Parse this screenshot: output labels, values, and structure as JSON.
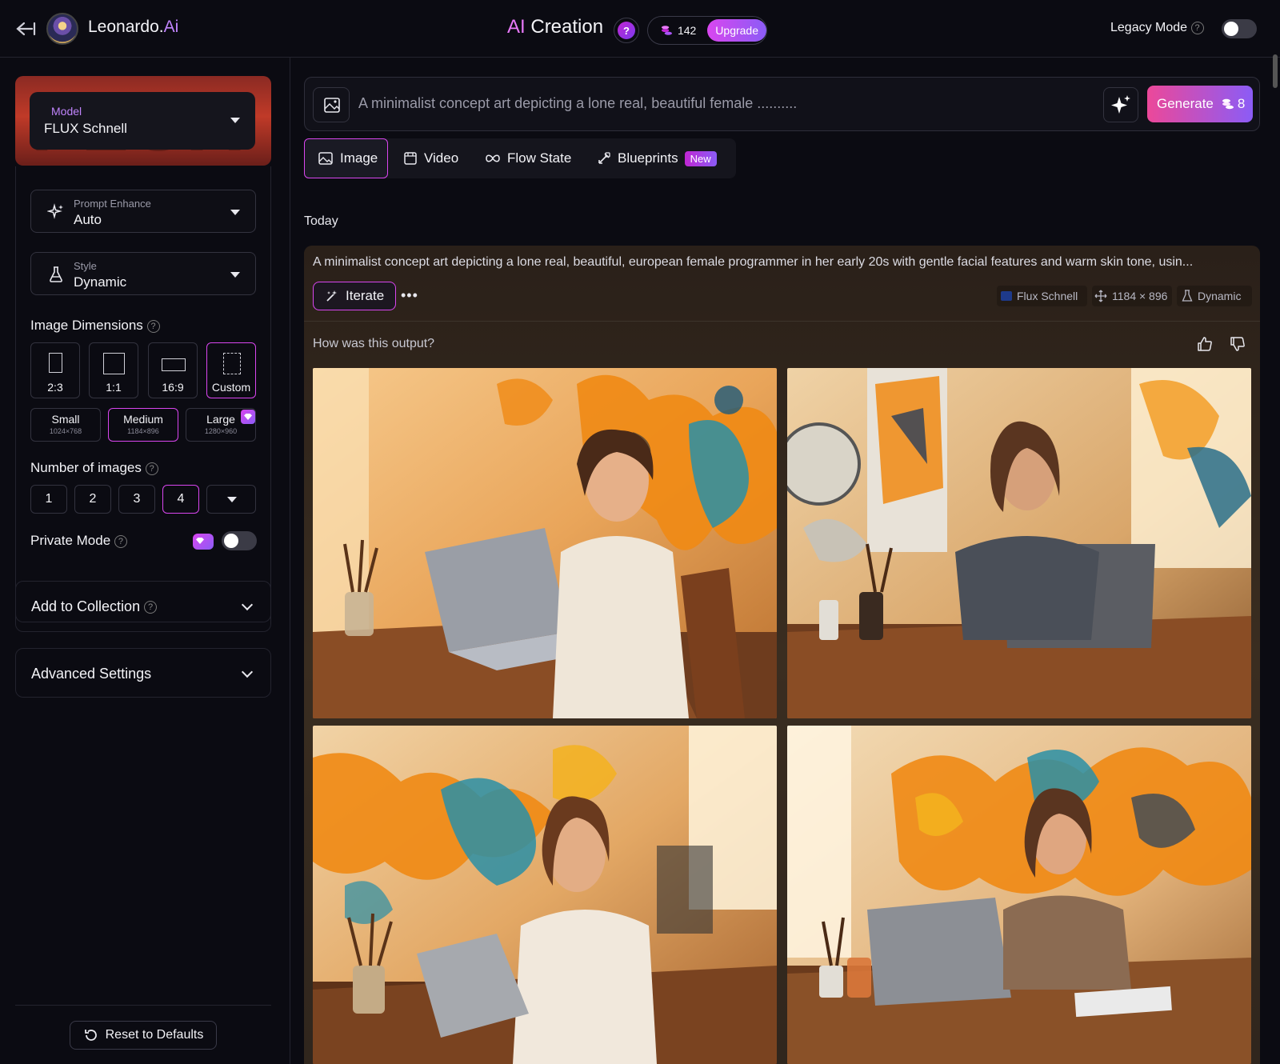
{
  "header": {
    "brand": "Leonardo.",
    "brand_ai": "Ai",
    "title_ai": "AI",
    "title": "Creation",
    "help": "?",
    "tokens": "142",
    "upgrade": "Upgrade",
    "legacy_mode": "Legacy Mode",
    "legacy_toggle_on": false
  },
  "sidebar": {
    "model_label": "Model",
    "model_value": "FLUX Schnell",
    "model_bg_text": "FLUX",
    "prompt_enhance_label": "Prompt Enhance",
    "prompt_enhance_value": "Auto",
    "style_label": "Style",
    "style_value": "Dynamic",
    "image_dimensions": "Image Dimensions",
    "ratios": [
      "2:3",
      "1:1",
      "16:9",
      "Custom"
    ],
    "active_ratio": "Custom",
    "sizes": [
      {
        "name": "Small",
        "dims": "1024×768"
      },
      {
        "name": "Medium",
        "dims": "1184×896"
      },
      {
        "name": "Large",
        "dims": "1280×960"
      }
    ],
    "active_size": "Medium",
    "number_of_images": "Number of images",
    "counts": [
      "1",
      "2",
      "3",
      "4"
    ],
    "active_count": "4",
    "private_mode": "Private Mode",
    "private_toggle_on": false,
    "add_to_collection": "Add to Collection",
    "advanced_settings": "Advanced Settings",
    "reset": "Reset to Defaults"
  },
  "main": {
    "prompt_placeholder": "A minimalist concept art depicting a lone real, beautiful female ..........",
    "generate": "Generate",
    "generate_cost": "8",
    "tabs": [
      "Image",
      "Video",
      "Flow State",
      "Blueprints"
    ],
    "active_tab": "Image",
    "new_badge": "New",
    "day_heading": "Today",
    "generation": {
      "prompt": "A minimalist concept art depicting a lone real, beautiful, european female programmer in her early 20s with gentle facial features and warm skin tone, usin...",
      "iterate": "Iterate",
      "more": "•••",
      "model": "Flux Schnell",
      "dimensions": "1184 × 896",
      "style": "Dynamic",
      "feedback_question": "How was this output?"
    }
  },
  "colors": {
    "accent": "#d946ef",
    "accent2": "#8b5cf6",
    "background": "#0b0b12"
  }
}
